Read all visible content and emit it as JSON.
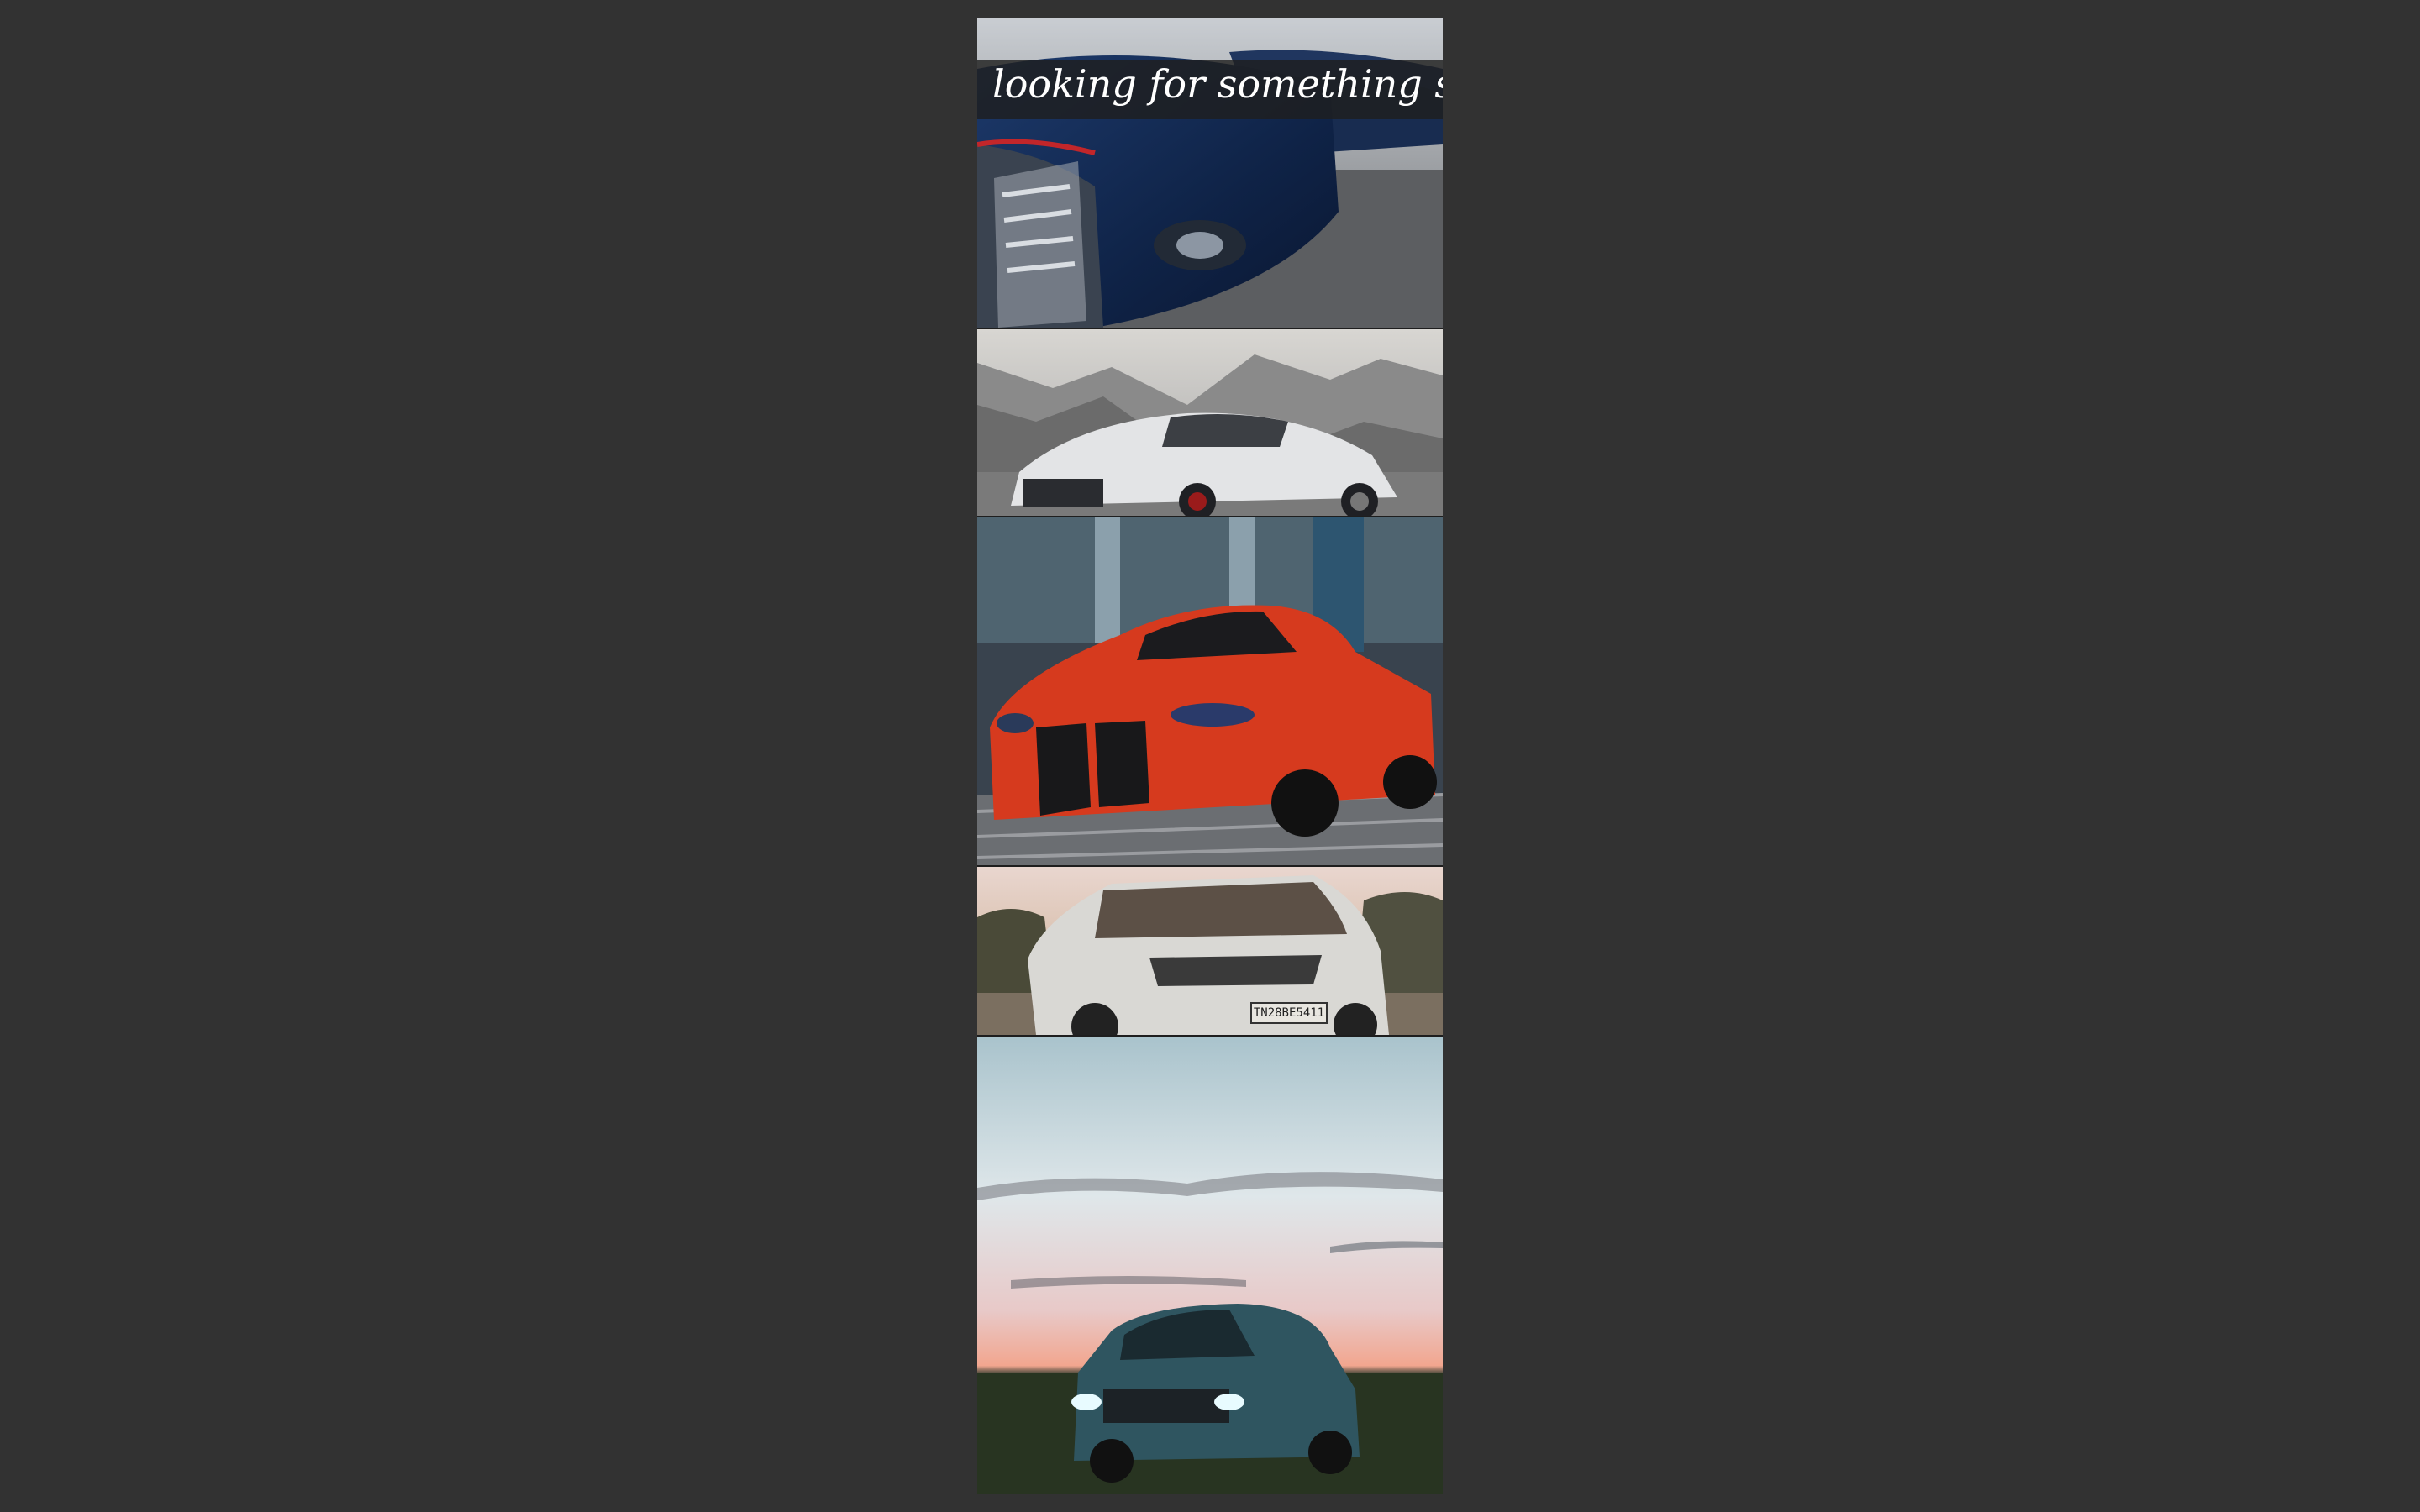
{
  "banner": {
    "text": "looking for something special"
  },
  "gallery": {
    "tiles": [
      {
        "name": "blue-sedans-row",
        "alt": "Row of blue sedans"
      },
      {
        "name": "white-sportback",
        "alt": "White sportback coupe in mountains"
      },
      {
        "name": "red-coupe",
        "alt": "Red coupe in front of glass building"
      },
      {
        "name": "white-suv",
        "alt": "White SUV",
        "plate": "TN28BE5411"
      },
      {
        "name": "teal-suv-sunset",
        "alt": "Dark teal SUV at sunset"
      }
    ]
  },
  "colors": {
    "background": "#323232",
    "banner_bg": "#1e1e1e",
    "banner_text": "#ffffff"
  }
}
